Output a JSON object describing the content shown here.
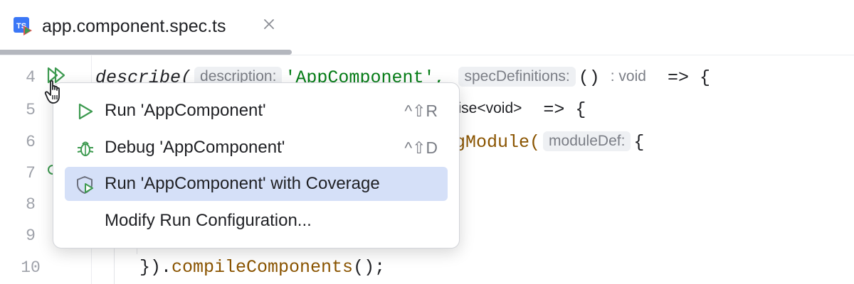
{
  "tab": {
    "title": "app.component.spec.ts",
    "icon_text": "TS",
    "icon": "typescript-test-file-icon",
    "close_icon": "close-icon"
  },
  "gutter": {
    "line_numbers": [
      "4",
      "5",
      "6",
      "7",
      "8",
      "9",
      "10"
    ]
  },
  "code": {
    "line4": {
      "fn": "describe(",
      "hint1": "description:",
      "str": "'AppComponent',",
      "hint2": "specDefinitions:",
      "paren": "()",
      "ret_hint": ": void",
      "arrow": "=> {"
    },
    "line5": {
      "tail": "mise<void>",
      "arrow": "=> {"
    },
    "line6": {
      "fn": "ngModule(",
      "hint": "moduleDef:",
      "brace": "{"
    },
    "line10": {
      "pre": "}).",
      "fn": "compileComponents",
      "post": "();"
    }
  },
  "popup": {
    "items": [
      {
        "label": "Run 'AppComponent'",
        "shortcut": "^⇧R",
        "icon": "run-icon"
      },
      {
        "label": "Debug 'AppComponent'",
        "shortcut": "^⇧D",
        "icon": "debug-icon"
      },
      {
        "label": "Run 'AppComponent' with Coverage",
        "shortcut": "",
        "icon": "coverage-icon"
      },
      {
        "label": "Modify Run Configuration...",
        "shortcut": ""
      }
    ]
  },
  "colors": {
    "accent_green": "#3d9a50",
    "selection": "#d5e0f8",
    "string": "#067d17",
    "function": "#8a5400",
    "ts_blue": "#3b77f6"
  }
}
